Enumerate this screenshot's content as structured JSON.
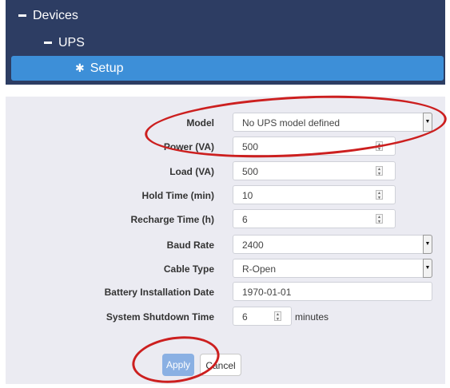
{
  "nav": {
    "devices": "Devices",
    "ups": "UPS",
    "setup": "Setup"
  },
  "form": {
    "model": {
      "label": "Model",
      "value": "No UPS model defined"
    },
    "power": {
      "label": "Power (VA)",
      "value": "500"
    },
    "load": {
      "label": "Load (VA)",
      "value": "500"
    },
    "hold_time": {
      "label": "Hold Time (min)",
      "value": "10"
    },
    "recharge_time": {
      "label": "Recharge Time (h)",
      "value": "6"
    },
    "baud_rate": {
      "label": "Baud Rate",
      "value": "2400"
    },
    "cable_type": {
      "label": "Cable Type",
      "value": "R-Open"
    },
    "battery_date": {
      "label": "Battery Installation Date",
      "value": "1970-01-01"
    },
    "shutdown_time": {
      "label": "System Shutdown Time",
      "value": "6",
      "unit": "minutes"
    }
  },
  "buttons": {
    "apply": "Apply",
    "cancel": "Cancel"
  },
  "colors": {
    "nav_bg": "#2d3d63",
    "nav_active": "#3d8fd8",
    "annotation": "#cc1f1f"
  },
  "icons": [
    "minus-icon",
    "gear-icon",
    "chevron-down-icon",
    "spinner-icon"
  ]
}
